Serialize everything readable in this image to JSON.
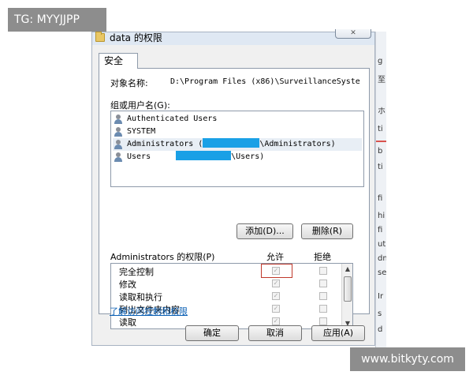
{
  "watermarks": {
    "top_left": "TG: MYYJJPP",
    "bottom_right": "www.bitkyty.com"
  },
  "window": {
    "title": "data 的权限",
    "close_label": "✕"
  },
  "tabs": [
    {
      "label": "安全",
      "selected": true
    }
  ],
  "object": {
    "label": "对象名称:",
    "path": "D:\\Program Files (x86)\\SurveillanceSyste"
  },
  "groups": {
    "label": "组或用户名(G):",
    "items": [
      {
        "name": "Authenticated Users"
      },
      {
        "name": "SYSTEM"
      },
      {
        "prefix": "Administrators (",
        "suffix": "\\Administrators)",
        "selected": true
      },
      {
        "prefix": "Users ",
        "suffix": "\\Users)"
      }
    ]
  },
  "buttons": {
    "add": "添加(D)...",
    "remove": "删除(R)",
    "ok": "确定",
    "cancel": "取消",
    "apply": "应用(A)"
  },
  "permissions": {
    "label": "Administrators 的权限(P)",
    "allow_header": "允许",
    "deny_header": "拒绝",
    "rows": [
      {
        "name": "完全控制",
        "allow": true,
        "deny": false
      },
      {
        "name": "修改",
        "allow": true,
        "deny": false
      },
      {
        "name": "读取和执行",
        "allow": true,
        "deny": false
      },
      {
        "name": "列出文件夹内容",
        "allow": true,
        "deny": false
      },
      {
        "name": "读取",
        "allow": true,
        "deny": false
      }
    ]
  },
  "link": {
    "learn_more": "了解访问控制和权限"
  },
  "background_fragments": [
    "g",
    "至",
    "ホ",
    "ti",
    "b",
    "ti",
    "fi",
    "hi",
    "fi",
    "ut",
    "dm",
    "se",
    "Ir",
    "s",
    "d"
  ],
  "colors": {
    "redaction": "#1aa0e6",
    "highlight": "#c0392b",
    "link": "#0a5fb4"
  }
}
